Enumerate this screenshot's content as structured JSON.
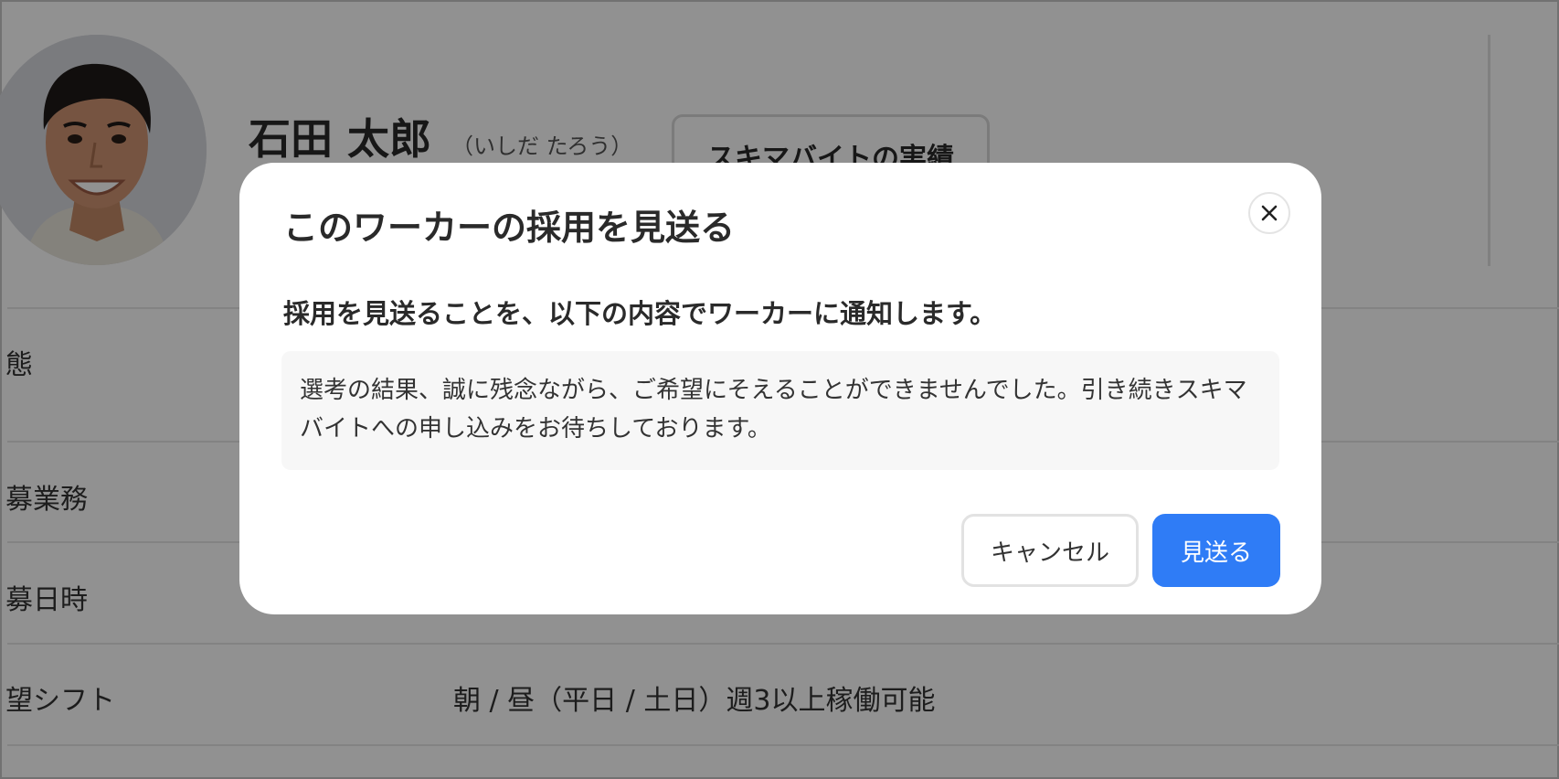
{
  "profile": {
    "name": "石田 太郎",
    "kana": "（いしだ たろう）",
    "record_button_label": "スキマバイトの実績"
  },
  "details": {
    "rows": [
      {
        "label": "態",
        "value": ""
      },
      {
        "label": "募業務",
        "value": ""
      },
      {
        "label": "募日時",
        "value": ""
      },
      {
        "label": "望シフト",
        "value": "朝 / 昼（平日 / 土日）週3以上稼働可能"
      }
    ]
  },
  "modal": {
    "title": "このワーカーの採用を見送る",
    "subtitle": "採用を見送ることを、以下の内容でワーカーに通知します。",
    "message": "選考の結果、誠に残念ながら、ご希望にそえることができませんでした。引き続きスキマバイトへの申し込みをお待ちしております。",
    "cancel_label": "キャンセル",
    "confirm_label": "見送る",
    "close_icon": "close-icon"
  },
  "colors": {
    "primary": "#2f7cf6",
    "overlay": "rgba(0,0,0,0.43)"
  }
}
